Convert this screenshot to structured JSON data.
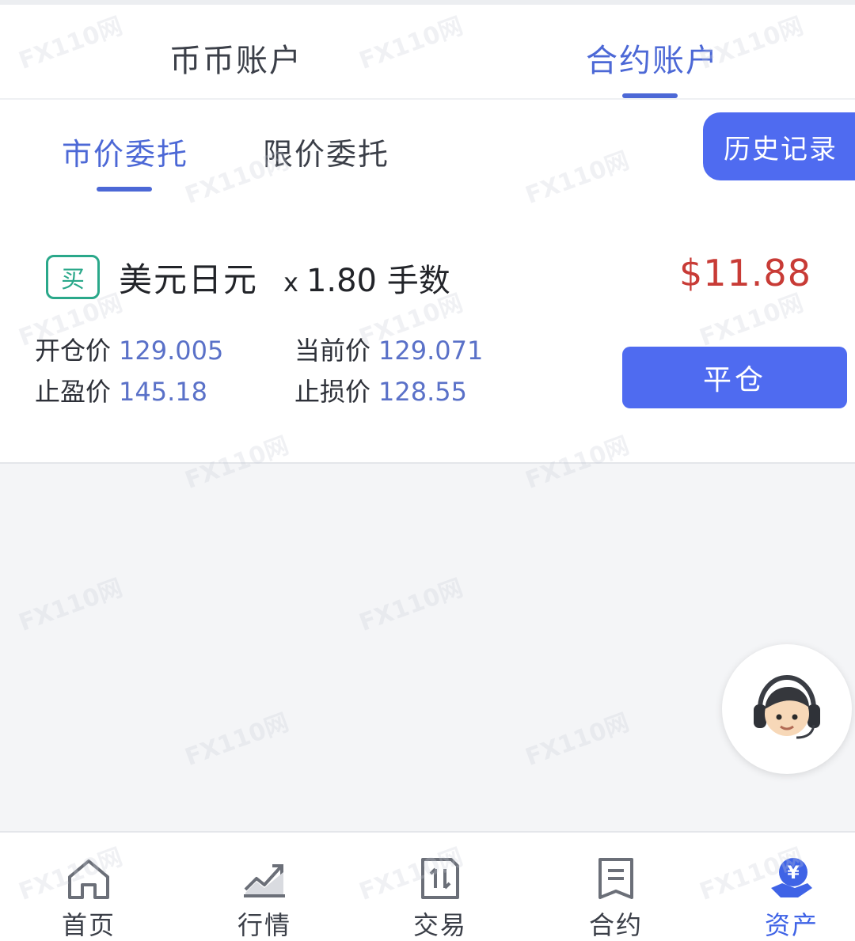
{
  "account_tabs": {
    "spot_label": "币币账户",
    "contract_label": "合约账户",
    "active": "contract"
  },
  "order_tabs": {
    "market_label": "市价委托",
    "limit_label": "限价委托",
    "active": "market",
    "history_label": "历史记录"
  },
  "position": {
    "side_label": "买",
    "pair": "美元日元",
    "multiplier": "x",
    "lots": "1.80 手数",
    "profit": "$11.88",
    "open_price_label": "开仓价",
    "open_price": "129.005",
    "current_price_label": "当前价",
    "current_price": "129.071",
    "take_profit_label": "止盈价",
    "take_profit": "145.18",
    "stop_loss_label": "止损价",
    "stop_loss": "128.55",
    "close_label": "平仓"
  },
  "bottom_nav": {
    "home": "首页",
    "market": "行情",
    "trade": "交易",
    "contract": "合约",
    "assets": "资产",
    "active": "assets"
  },
  "watermark_text": "FX110网",
  "colors": {
    "accent": "#4f6bf0",
    "tab_active": "#4c68d6",
    "profit": "#c83b36",
    "buy": "#2aa88a",
    "value": "#5a71c8"
  }
}
